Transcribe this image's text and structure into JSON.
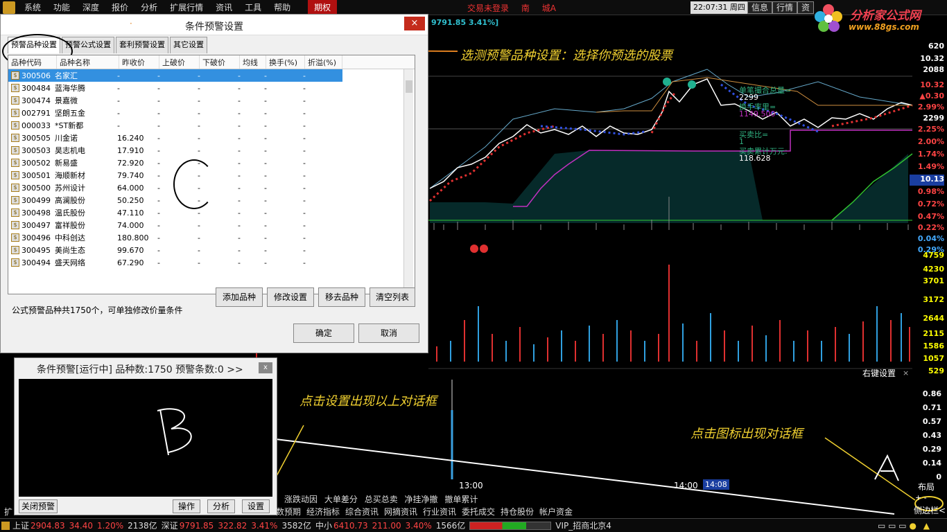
{
  "menu": {
    "items": [
      "系统",
      "功能",
      "深度",
      "报价",
      "分析",
      "扩展行情",
      "资讯",
      "工具",
      "帮助"
    ],
    "active": "期权",
    "login_status": "交易未登录",
    "login_extra": "南",
    "login_extra2": "城A",
    "clock": "22:07:31 周四",
    "btn_info": "信息",
    "btn_quote": "行情",
    "btn_trade": "资"
  },
  "brand": {
    "name": "分析家公式网",
    "url": "www.88gs.com"
  },
  "chart": {
    "index_readout": "9791.85  3.41%]",
    "overlay": {
      "line1_label": "单笔撮合总量=",
      "line1_value": "2299",
      "line2_label": "换手率里=",
      "line2_value": "1149.500",
      "line3_label": "买卖比=",
      "line3_value": "1",
      "line4_label": "买卖累计万元:",
      "line4_value": "118.628"
    },
    "price_axis": [
      {
        "v": "620",
        "color": "#ffffff"
      },
      {
        "v": "10.32",
        "color": "#ffffff"
      },
      {
        "v": "2088",
        "color": "#ffffff"
      },
      {
        "v": "10.32",
        "color": "#ff4040"
      },
      {
        "v": "▲0.30",
        "color": "#ff4040"
      },
      {
        "v": "2.99%",
        "color": "#ff4040"
      },
      {
        "v": "2299",
        "color": "#ffffff"
      },
      {
        "v": "2.25%",
        "color": "#ff4040"
      },
      {
        "v": "2.00%",
        "color": "#ff4040"
      },
      {
        "v": "1.74%",
        "color": "#ff4040"
      },
      {
        "v": "1.49%",
        "color": "#ff4040"
      },
      {
        "v": "10.13",
        "color": "#ffffff"
      },
      {
        "v": "0.98%",
        "color": "#ff4040"
      },
      {
        "v": "0.72%",
        "color": "#ff4040"
      },
      {
        "v": "0.47%",
        "color": "#ff4040"
      },
      {
        "v": "0.22%",
        "color": "#ff4040"
      },
      {
        "v": "0.04%",
        "color": "#40a0ff"
      },
      {
        "v": "0.29%",
        "color": "#40a0ff"
      }
    ],
    "volume_axis": [
      "4759",
      "4230",
      "3701",
      "3172",
      "2644",
      "2115",
      "1586",
      "1057",
      "529"
    ],
    "lower_axis": [
      "0.86",
      "0.71",
      "0.57",
      "0.43",
      "0.29",
      "0.14",
      "0"
    ],
    "right_click_settings": "右键设置",
    "time_1300": "13:00",
    "time_1400": "14:00",
    "time_1408": "14:08",
    "layout_label": "布局",
    "side_label": "侧边栏<"
  },
  "annotations": {
    "top": "选测预警品种设置：选择你预选的股票",
    "middle": "点击设置出现以上对话框",
    "right": "点击图标出现对话框",
    "letter_a": "A",
    "letter_b": "B",
    "letter_c": "C"
  },
  "dialog": {
    "title": "条件预警设置",
    "close": "×",
    "tabs": [
      "预警品种设置",
      "预警公式设置",
      "套利预警设置",
      "其它设置"
    ],
    "columns": [
      "品种代码",
      "品种名称",
      "昨收价",
      "上破价",
      "下破价",
      "均线",
      "换手(%)",
      "折溢(%)"
    ],
    "rows": [
      [
        "300506",
        "名家汇",
        "-",
        "-",
        "-",
        "-",
        "-",
        "-"
      ],
      [
        "300484",
        "蓝海华腾",
        "-",
        "-",
        "-",
        "-",
        "-",
        "-"
      ],
      [
        "300474",
        "景嘉微",
        "-",
        "-",
        "-",
        "-",
        "-",
        "-"
      ],
      [
        "002791",
        "坚朗五金",
        "-",
        "-",
        "-",
        "-",
        "-",
        "-"
      ],
      [
        "000033",
        "*ST新都",
        "-",
        "-",
        "-",
        "-",
        "-",
        "-"
      ],
      [
        "300505",
        "川金诺",
        "16.240",
        "-",
        "-",
        "-",
        "-",
        "-"
      ],
      [
        "300503",
        "昊志机电",
        "17.910",
        "-",
        "-",
        "-",
        "-",
        "-"
      ],
      [
        "300502",
        "新易盛",
        "72.920",
        "-",
        "-",
        "-",
        "-",
        "-"
      ],
      [
        "300501",
        "海顺新材",
        "79.740",
        "-",
        "-",
        "-",
        "-",
        "-"
      ],
      [
        "300500",
        "苏州设计",
        "64.000",
        "-",
        "-",
        "-",
        "-",
        "-"
      ],
      [
        "300499",
        "高澜股份",
        "50.250",
        "-",
        "-",
        "-",
        "-",
        "-"
      ],
      [
        "300498",
        "温氏股份",
        "47.110",
        "-",
        "-",
        "-",
        "-",
        "-"
      ],
      [
        "300497",
        "富祥股份",
        "74.000",
        "-",
        "-",
        "-",
        "-",
        "-"
      ],
      [
        "300496",
        "中科创达",
        "180.800",
        "-",
        "-",
        "-",
        "-",
        "-"
      ],
      [
        "300495",
        "美尚生态",
        "99.670",
        "-",
        "-",
        "-",
        "-",
        "-"
      ],
      [
        "300494",
        "盛天网络",
        "67.290",
        "-",
        "-",
        "-",
        "-",
        "-"
      ]
    ],
    "info": "公式预警品种共1750个，可单独修改价量条件",
    "btn_add": "添加品种",
    "btn_edit": "修改设置",
    "btn_remove": "移去品种",
    "btn_clear": "清空列表",
    "btn_ok": "确定",
    "btn_cancel": "取消"
  },
  "dialog_b": {
    "title": "条件预警[运行中] 品种数:1750 预警条数:0  >>",
    "close": "x",
    "btn_close_alert": "关闭预警",
    "btn_op": "操作",
    "btn_analyze": "分析",
    "btn_settings": "设置"
  },
  "tabs_row1": [
    "涨跌动因",
    "大单差分",
    "总买总卖",
    "净挂净撤",
    "撤单累计"
  ],
  "tabs_row2": [
    "扩",
    "数预期",
    "经济指标",
    "综合资讯",
    "网摘资讯",
    "行业资讯",
    "委托成交",
    "持仓股份",
    "帐户资金"
  ],
  "statusbar": {
    "sh_label": "上证",
    "sh_value": "2904.83",
    "sh_change": "34.40",
    "sh_pct": "1.20%",
    "sh_amount": "2138亿",
    "sz_label": "深证",
    "sz_value": "9791.85",
    "sz_change": "322.82",
    "sz_pct": "3.41%",
    "sz_amount": "3582亿",
    "zx_label": "中小",
    "zx_value": "6410.73",
    "zx_change": "211.00",
    "zx_pct": "3.40%",
    "zx_amount": "1566亿",
    "broker": "VIP_招商北京4"
  }
}
